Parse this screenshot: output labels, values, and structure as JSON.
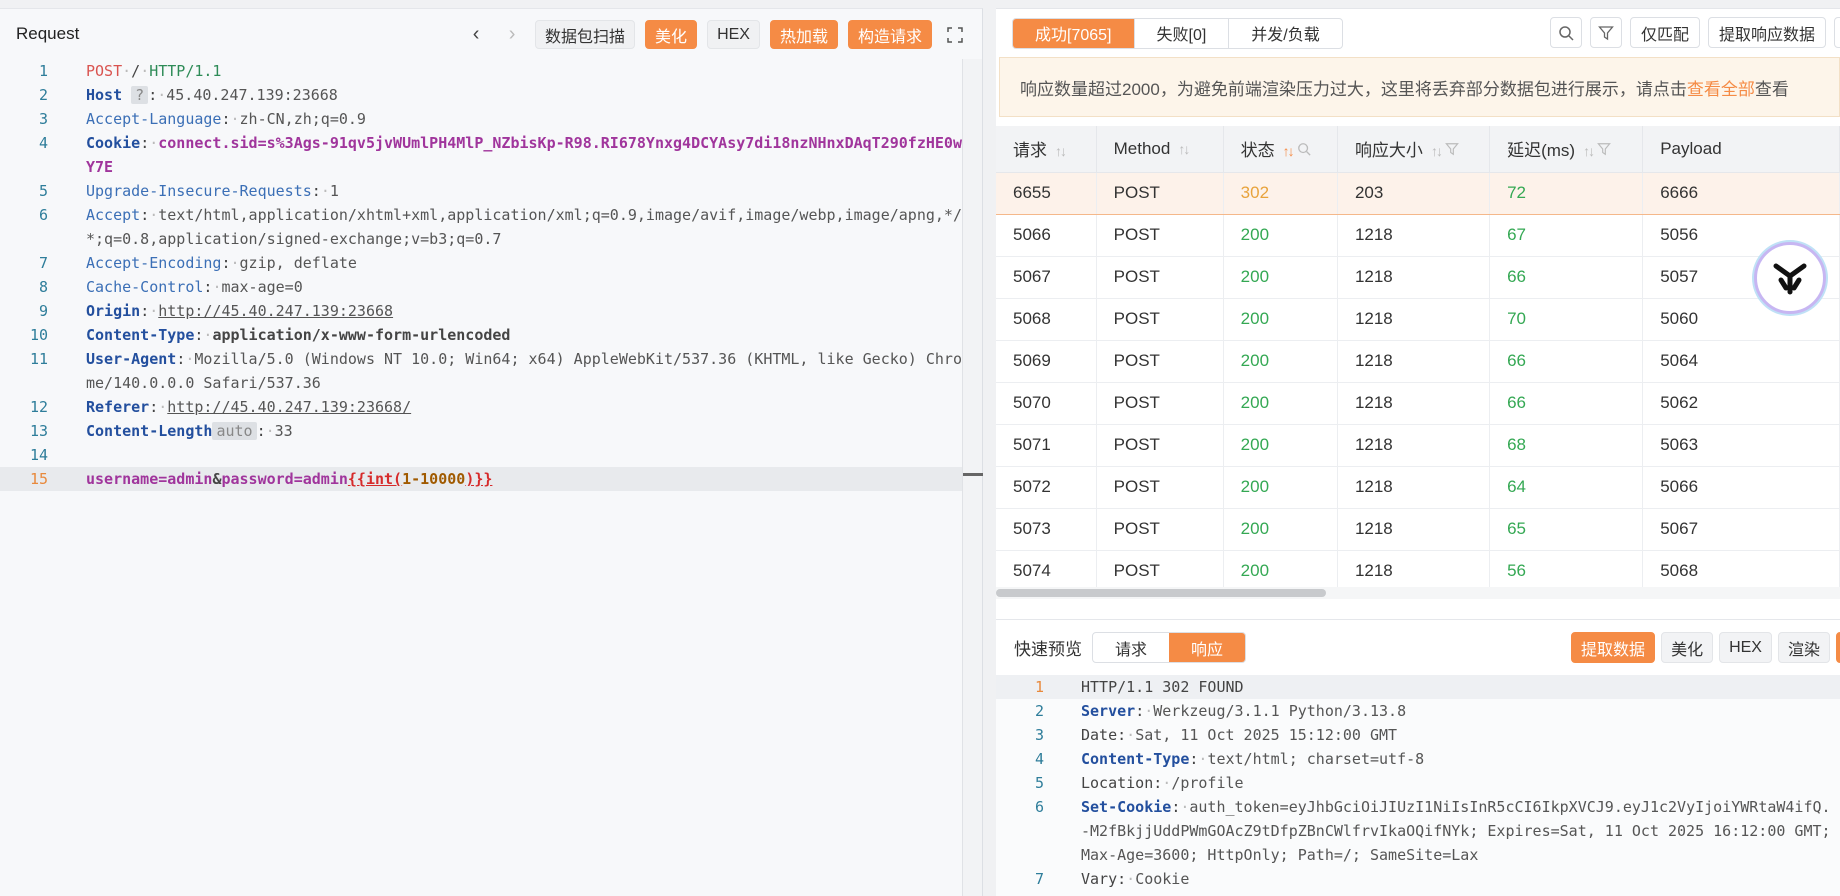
{
  "request_pane": {
    "title": "Request",
    "buttons": {
      "scan": "数据包扫描",
      "beautify": "美化",
      "hex": "HEX",
      "hotload": "热加载",
      "construct": "构造请求"
    },
    "lines": [
      {
        "n": "1",
        "method": "POST",
        "path": "/",
        "proto": "HTTP/1.1"
      },
      {
        "n": "2",
        "key": "Host",
        "badge": "?",
        "value": "45.40.247.139:23668"
      },
      {
        "n": "3",
        "key": "Accept-Language",
        "value": "zh-CN,zh;q=0.9"
      },
      {
        "n": "4",
        "key": "Cookie",
        "value": "connect.sid=s%3Ags-91qv5jvWUmlPH4MlP_NZbisKp-R98.RI678Ynxg4DCYAsy7di18nzNHnxDAqT290fzHE0wY7E"
      },
      {
        "n": "5",
        "key": "Upgrade-Insecure-Requests",
        "value": "1"
      },
      {
        "n": "6",
        "key": "Accept",
        "value": "text/html,application/xhtml+xml,application/xml;q=0.9,image/avif,image/webp,image/apng,*/*;q=0.8,application/signed-exchange;v=b3;q=0.7"
      },
      {
        "n": "7",
        "key": "Accept-Encoding",
        "value": "gzip, deflate"
      },
      {
        "n": "8",
        "key": "Cache-Control",
        "value": "max-age=0"
      },
      {
        "n": "9",
        "key": "Origin",
        "value": "http://45.40.247.139:23668"
      },
      {
        "n": "10",
        "key": "Content-Type",
        "value": "application/x-www-form-urlencoded"
      },
      {
        "n": "11",
        "key": "User-Agent",
        "value": "Mozilla/5.0 (Windows NT 10.0; Win64; x64) AppleWebKit/537.36 (KHTML, like Gecko) Chrome/140.0.0.0 Safari/537.36"
      },
      {
        "n": "12",
        "key": "Referer",
        "value": "http://45.40.247.139:23668/"
      },
      {
        "n": "13",
        "key": "Content-Length",
        "badge": "auto",
        "value": "33"
      },
      {
        "n": "14"
      },
      {
        "n": "15",
        "body": {
          "k1": "username",
          "v1": "admin",
          "amp": "&",
          "k2": "password",
          "v2": "admin",
          "tpl_open": "{{int(",
          "tpl_num": "1-10000",
          "tpl_close": ")}}"
        }
      }
    ]
  },
  "results_pane": {
    "tabs": {
      "success": "成功[7065]",
      "failed": "失败[0]",
      "concurrency": "并发/负载"
    },
    "buttons": {
      "match_only": "仅匹配",
      "extract": "提取响应数据"
    },
    "notice": {
      "text": "响应数量超过2000，为避免前端渲染压力过大，这里将丢弃部分数据包进行展示，请点击",
      "link": "查看全部",
      "tail": "查看"
    },
    "columns": [
      "请求",
      "Method",
      "状态",
      "响应大小",
      "延迟(ms)",
      "Payload"
    ],
    "rows": [
      [
        "6655",
        "POST",
        "302",
        "203",
        "72",
        "6666"
      ],
      [
        "5066",
        "POST",
        "200",
        "1218",
        "67",
        "5056"
      ],
      [
        "5067",
        "POST",
        "200",
        "1218",
        "66",
        "5057"
      ],
      [
        "5068",
        "POST",
        "200",
        "1218",
        "70",
        "5060"
      ],
      [
        "5069",
        "POST",
        "200",
        "1218",
        "66",
        "5064"
      ],
      [
        "5070",
        "POST",
        "200",
        "1218",
        "66",
        "5062"
      ],
      [
        "5071",
        "POST",
        "200",
        "1218",
        "68",
        "5063"
      ],
      [
        "5072",
        "POST",
        "200",
        "1218",
        "64",
        "5066"
      ],
      [
        "5073",
        "POST",
        "200",
        "1218",
        "65",
        "5067"
      ],
      [
        "5074",
        "POST",
        "200",
        "1218",
        "56",
        "5068"
      ]
    ]
  },
  "preview": {
    "label": "快速预览",
    "tabs": {
      "request": "请求",
      "response": "响应"
    },
    "buttons": {
      "extract": "提取数据",
      "beautify": "美化",
      "hex": "HEX",
      "render": "渲染"
    },
    "lines": [
      {
        "n": "1",
        "text": "HTTP/1.1 302 FOUND"
      },
      {
        "n": "2",
        "key": "Server",
        "value": "Werkzeug/3.1.1 Python/3.13.8"
      },
      {
        "n": "3",
        "plain_key": "Date",
        "value": "Sat, 11 Oct 2025 15:12:00 GMT"
      },
      {
        "n": "4",
        "key": "Content-Type",
        "value": "text/html; charset=utf-8"
      },
      {
        "n": "5",
        "plain_key": "Location",
        "value": "/profile"
      },
      {
        "n": "6",
        "key": "Set-Cookie",
        "value": "auth_token=eyJhbGciOiJIUzI1NiIsInR5cCI6IkpXVCJ9.eyJ1c2VyIjoiYWRtaW4ifQ.-M2fBkjjUddPWmGOAcZ9tDfpZBnCWlfrvIkaOQifNYk; Expires=Sat, 11 Oct 2025 16:12:00 GMT; Max-Age=3600; HttpOnly; Path=/; SameSite=Lax"
      },
      {
        "n": "7",
        "plain_key": "Vary",
        "value": "Cookie"
      }
    ]
  },
  "colors": {
    "accent": "#f58b45",
    "status_302": "#e8a33c",
    "status_200": "#34a853"
  }
}
